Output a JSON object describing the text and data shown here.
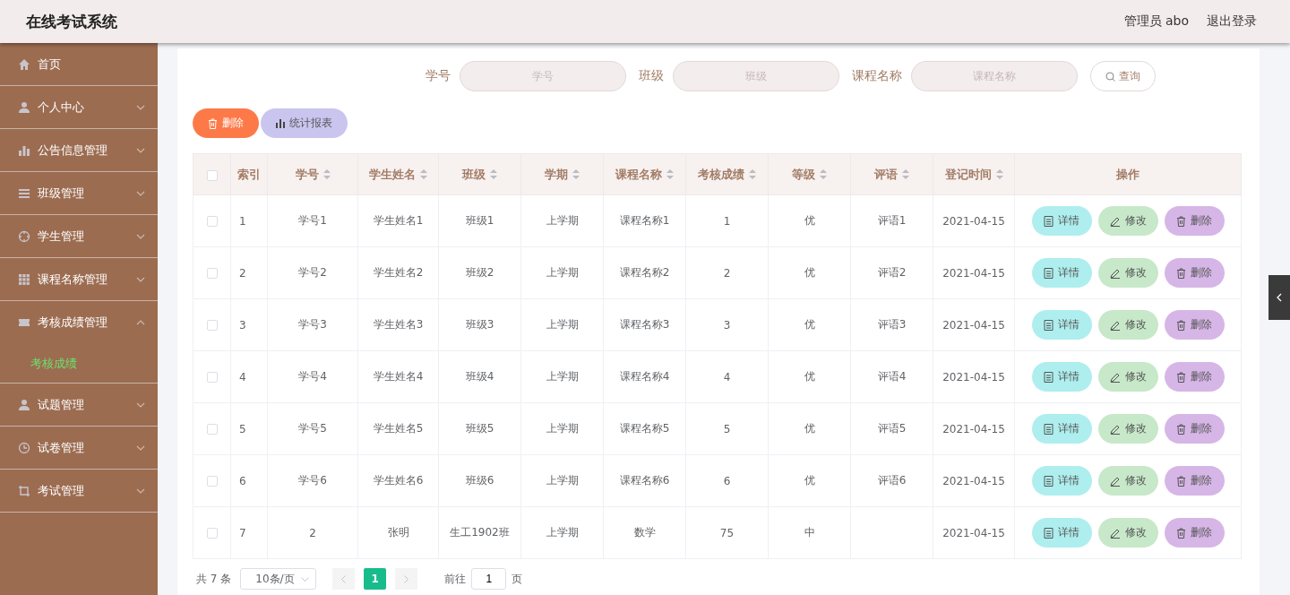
{
  "header": {
    "title": "在线考试系统",
    "user": "管理员 abo",
    "logout": "退出登录"
  },
  "sidebar": {
    "items": [
      {
        "label": "首页"
      },
      {
        "label": "个人中心",
        "expanded": false
      },
      {
        "label": "公告信息管理",
        "expanded": false
      },
      {
        "label": "班级管理",
        "expanded": false
      },
      {
        "label": "学生管理",
        "expanded": false
      },
      {
        "label": "课程名称管理",
        "expanded": false
      },
      {
        "label": "考核成绩管理",
        "expanded": true,
        "children": [
          {
            "label": "考核成绩",
            "selected": true
          }
        ]
      },
      {
        "label": "试题管理",
        "expanded": false
      },
      {
        "label": "试卷管理",
        "expanded": false
      },
      {
        "label": "考试管理",
        "expanded": false
      }
    ]
  },
  "search": {
    "fields": [
      {
        "label": "学号",
        "placeholder": "学号"
      },
      {
        "label": "班级",
        "placeholder": "班级"
      },
      {
        "label": "课程名称",
        "placeholder": "课程名称"
      }
    ],
    "button": "查询"
  },
  "actions": [
    {
      "label": "删除",
      "kind": "delete"
    },
    {
      "label": "统计报表",
      "kind": "report"
    }
  ],
  "table": {
    "select_all_checked": false,
    "columns": [
      {
        "label": "索引",
        "sortable": false
      },
      {
        "label": "学号",
        "sortable": true
      },
      {
        "label": "学生姓名",
        "sortable": true
      },
      {
        "label": "班级",
        "sortable": true
      },
      {
        "label": "学期",
        "sortable": true
      },
      {
        "label": "课程名称",
        "sortable": true
      },
      {
        "label": "考核成绩",
        "sortable": true
      },
      {
        "label": "等级",
        "sortable": true
      },
      {
        "label": "评语",
        "sortable": true
      },
      {
        "label": "登记时间",
        "sortable": true
      },
      {
        "label": "操作",
        "sortable": false
      }
    ],
    "rows": [
      {
        "checked": false,
        "cells": [
          "1",
          "学号1",
          "学生姓名1",
          "班级1",
          "上学期",
          "课程名称1",
          "1",
          "优",
          "评语1",
          "2021-04-15"
        ],
        "actions": [
          {
            "label": "详情",
            "kind": "detail"
          },
          {
            "label": "修改",
            "kind": "edit"
          },
          {
            "label": "删除",
            "kind": "delete"
          }
        ]
      },
      {
        "checked": false,
        "cells": [
          "2",
          "学号2",
          "学生姓名2",
          "班级2",
          "上学期",
          "课程名称2",
          "2",
          "优",
          "评语2",
          "2021-04-15"
        ],
        "actions": [
          {
            "label": "详情",
            "kind": "detail"
          },
          {
            "label": "修改",
            "kind": "edit"
          },
          {
            "label": "删除",
            "kind": "delete"
          }
        ]
      },
      {
        "checked": false,
        "cells": [
          "3",
          "学号3",
          "学生姓名3",
          "班级3",
          "上学期",
          "课程名称3",
          "3",
          "优",
          "评语3",
          "2021-04-15"
        ],
        "actions": [
          {
            "label": "详情",
            "kind": "detail"
          },
          {
            "label": "修改",
            "kind": "edit"
          },
          {
            "label": "删除",
            "kind": "delete"
          }
        ]
      },
      {
        "checked": false,
        "cells": [
          "4",
          "学号4",
          "学生姓名4",
          "班级4",
          "上学期",
          "课程名称4",
          "4",
          "优",
          "评语4",
          "2021-04-15"
        ],
        "actions": [
          {
            "label": "详情",
            "kind": "detail"
          },
          {
            "label": "修改",
            "kind": "edit"
          },
          {
            "label": "删除",
            "kind": "delete"
          }
        ]
      },
      {
        "checked": false,
        "cells": [
          "5",
          "学号5",
          "学生姓名5",
          "班级5",
          "上学期",
          "课程名称5",
          "5",
          "优",
          "评语5",
          "2021-04-15"
        ],
        "actions": [
          {
            "label": "详情",
            "kind": "detail"
          },
          {
            "label": "修改",
            "kind": "edit"
          },
          {
            "label": "删除",
            "kind": "delete"
          }
        ]
      },
      {
        "checked": false,
        "cells": [
          "6",
          "学号6",
          "学生姓名6",
          "班级6",
          "上学期",
          "课程名称6",
          "6",
          "优",
          "评语6",
          "2021-04-15"
        ],
        "actions": [
          {
            "label": "详情",
            "kind": "detail"
          },
          {
            "label": "修改",
            "kind": "edit"
          },
          {
            "label": "删除",
            "kind": "delete"
          }
        ]
      },
      {
        "checked": false,
        "cells": [
          "7",
          "2",
          "张明",
          "生工1902班",
          "上学期",
          "数学",
          "75",
          "中",
          "",
          "2021-04-15"
        ],
        "actions": [
          {
            "label": "详情",
            "kind": "detail"
          },
          {
            "label": "修改",
            "kind": "edit"
          },
          {
            "label": "删除",
            "kind": "delete"
          }
        ]
      }
    ]
  },
  "pagination": {
    "total": "共 7 条",
    "page_size": "10条/页",
    "pages": [
      {
        "label": "1",
        "selected": true
      }
    ],
    "goto_label": "前往",
    "goto_value": "1",
    "goto_suffix": "页"
  }
}
